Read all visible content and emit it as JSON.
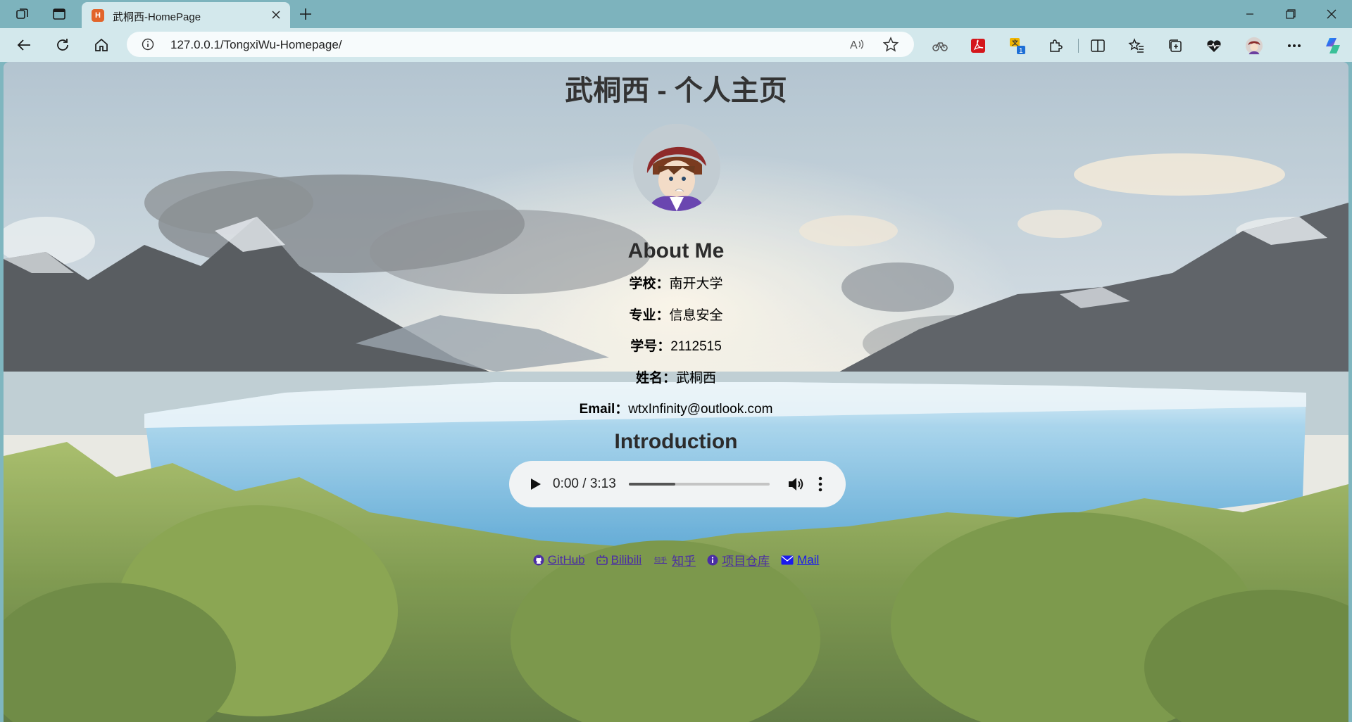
{
  "browser": {
    "tab_title": "武桐西-HomePage",
    "tab_favicon_text": "H",
    "url": "127.0.0.1/TongxiWu-Homepage/",
    "extension_badge": "1"
  },
  "page": {
    "title": "武桐西 - 个人主页",
    "about_heading": "About Me",
    "info": [
      {
        "label": "学校：",
        "value": "南开大学"
      },
      {
        "label": "专业：",
        "value": "信息安全"
      },
      {
        "label": "学号：",
        "value": "2112515"
      },
      {
        "label": "姓名：",
        "value": "武桐西"
      },
      {
        "label": "Email：",
        "value": "wtxInfinity@outlook.com"
      }
    ],
    "intro_heading": "Introduction",
    "audio": {
      "time": "0:00 / 3:13",
      "buffered_fraction": 0.33
    },
    "links": [
      {
        "label": "GitHub",
        "icon": "github-icon"
      },
      {
        "label": "Bilibili",
        "icon": "bilibili-icon"
      },
      {
        "label": "知乎",
        "icon": "zhihu-icon",
        "icon_text": "知乎"
      },
      {
        "label": "项目仓库",
        "icon": "info-icon"
      },
      {
        "label": "Mail",
        "icon": "mail-icon"
      }
    ]
  },
  "colors": {
    "chrome_tabbar": "#7db3bd",
    "chrome_toolbar": "#d3e8ec",
    "link": "#4b2ea4",
    "mail_link": "#1a1aee"
  }
}
